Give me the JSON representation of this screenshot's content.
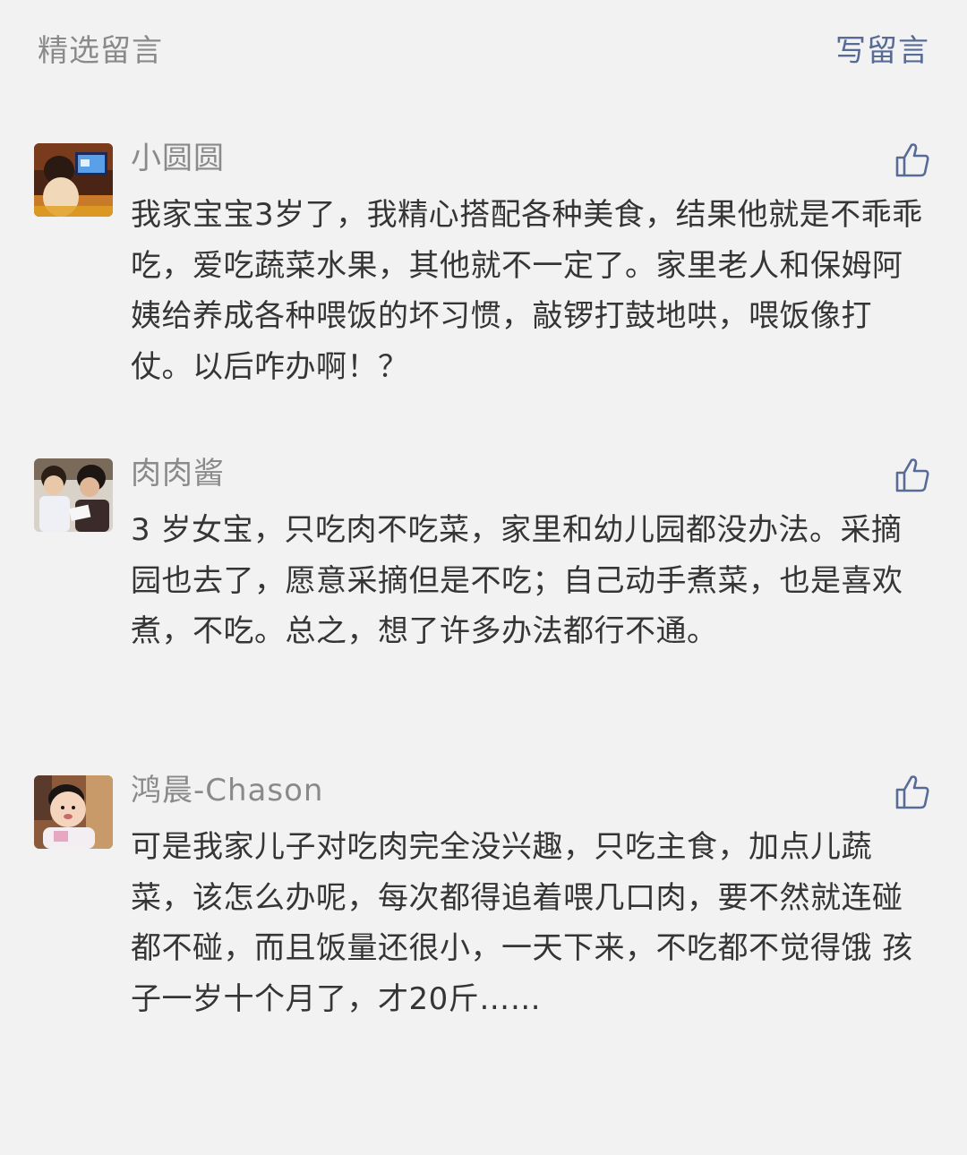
{
  "header": {
    "title": "精选留言",
    "write_label": "写留言"
  },
  "accent_color": "#576b95",
  "comments": [
    {
      "nickname": "小圆圆",
      "avatar_icon": "toddler-watching-tv-avatar",
      "content": "我家宝宝3岁了，我精心搭配各种美食，结果他就是不乖乖吃，爱吃蔬菜水果，其他就不一定了。家里老人和保姆阿姨给养成各种喂饭的坏习惯，敲锣打鼓地哄，喂饭像打仗。以后咋办啊！？"
    },
    {
      "nickname": "肉肉酱",
      "avatar_icon": "children-reading-avatar",
      "content": "3 岁女宝，只吃肉不吃菜，家里和幼儿园都没办法。采摘园也去了，愿意采摘但是不吃；自己动手煮菜，也是喜欢煮，不吃。总之，想了许多办法都行不通。"
    },
    {
      "nickname": "鸿晨-Chason",
      "avatar_icon": "baby-photo-avatar",
      "content": "可是我家儿子对吃肉完全没兴趣，只吃主食，加点儿蔬菜，该怎么办呢，每次都得追着喂几口肉，要不然就连碰都不碰，而且饭量还很小，一天下来，不吃都不觉得饿 孩子一岁十个月了，才20斤……"
    }
  ]
}
